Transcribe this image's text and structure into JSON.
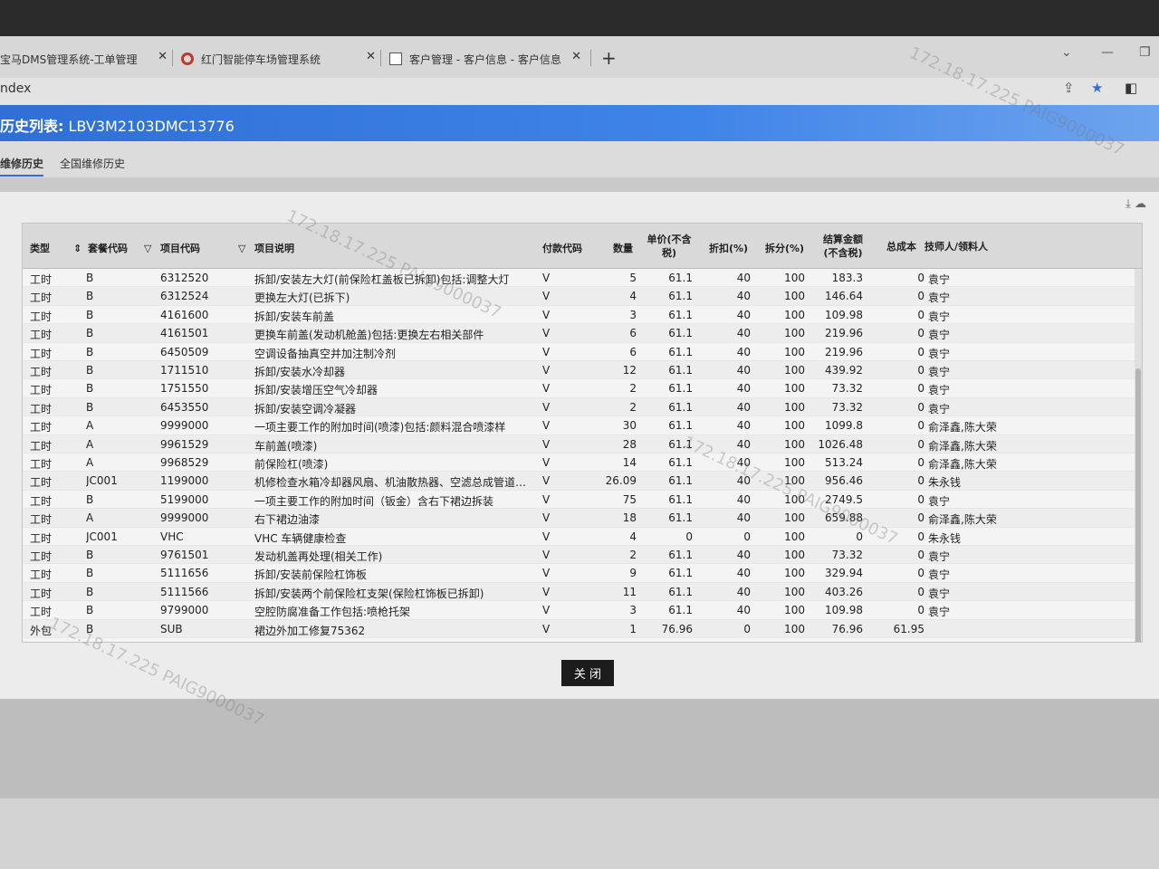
{
  "browser": {
    "tabs": [
      {
        "label": "宝马DMS管理系统-工单管理",
        "close": "✕"
      },
      {
        "label": "红门智能停车场管理系统",
        "close": "✕"
      },
      {
        "label": "客户管理 - 客户信息 - 客户信息",
        "close": "✕"
      }
    ],
    "new_tab": "+",
    "address": "ndex"
  },
  "app": {
    "title_prefix": "历史列表:",
    "vin": "LBV3M2103DMC13776",
    "subtabs": [
      "维修历史",
      "全国维修历史"
    ]
  },
  "table": {
    "headers": [
      "类型",
      "套餐代码",
      "项目代码",
      "项目说明",
      "付款代码",
      "数量",
      "单价(不含税)",
      "折扣(%)",
      "拆分(%)",
      "结算金额(不含税)",
      "总成本",
      "技师人/领料人"
    ],
    "rows": [
      [
        "工时",
        "B",
        "6312520",
        "拆卸/安装左大灯(前保险杠盖板已拆卸)包括:调整大灯",
        "V",
        "5",
        "61.1",
        "40",
        "100",
        "183.3",
        "0",
        "袁宁"
      ],
      [
        "工时",
        "B",
        "6312524",
        "更换左大灯(已拆下)",
        "V",
        "4",
        "61.1",
        "40",
        "100",
        "146.64",
        "0",
        "袁宁"
      ],
      [
        "工时",
        "B",
        "4161600",
        "拆卸/安装车前盖",
        "V",
        "3",
        "61.1",
        "40",
        "100",
        "109.98",
        "0",
        "袁宁"
      ],
      [
        "工时",
        "B",
        "4161501",
        "更换车前盖(发动机舱盖)包括:更换左右相关部件",
        "V",
        "6",
        "61.1",
        "40",
        "100",
        "219.96",
        "0",
        "袁宁"
      ],
      [
        "工时",
        "B",
        "6450509",
        "空调设备抽真空并加注制冷剂",
        "V",
        "6",
        "61.1",
        "40",
        "100",
        "219.96",
        "0",
        "袁宁"
      ],
      [
        "工时",
        "B",
        "1711510",
        "拆卸/安装水冷却器",
        "V",
        "12",
        "61.1",
        "40",
        "100",
        "439.92",
        "0",
        "袁宁"
      ],
      [
        "工时",
        "B",
        "1751550",
        "拆卸/安装增压空气冷却器",
        "V",
        "2",
        "61.1",
        "40",
        "100",
        "73.32",
        "0",
        "袁宁"
      ],
      [
        "工时",
        "B",
        "6453550",
        "拆卸/安装空调冷凝器",
        "V",
        "2",
        "61.1",
        "40",
        "100",
        "73.32",
        "0",
        "袁宁"
      ],
      [
        "工时",
        "A",
        "9999000",
        "一项主要工作的附加时间(喷漆)包括:颜料混合喷漆样",
        "V",
        "30",
        "61.1",
        "40",
        "100",
        "1099.8",
        "0",
        "俞泽鑫,陈大荣"
      ],
      [
        "工时",
        "A",
        "9961529",
        "车前盖(喷漆)",
        "V",
        "28",
        "61.1",
        "40",
        "100",
        "1026.48",
        "0",
        "俞泽鑫,陈大荣"
      ],
      [
        "工时",
        "A",
        "9968529",
        "前保险杠(喷漆)",
        "V",
        "14",
        "61.1",
        "40",
        "100",
        "513.24",
        "0",
        "俞泽鑫,陈大荣"
      ],
      [
        "工时",
        "JC001",
        "1199000",
        "机修检查水箱冷却器风扇、机油散热器、空滤总成管道等...",
        "V",
        "26.09",
        "61.1",
        "40",
        "100",
        "956.46",
        "0",
        "朱永钱"
      ],
      [
        "工时",
        "B",
        "5199000",
        "一项主要工作的附加时间（钣金）含右下裙边拆装",
        "V",
        "75",
        "61.1",
        "40",
        "100",
        "2749.5",
        "0",
        "袁宁"
      ],
      [
        "工时",
        "A",
        "9999000",
        "右下裙边油漆",
        "V",
        "18",
        "61.1",
        "40",
        "100",
        "659.88",
        "0",
        "俞泽鑫,陈大荣"
      ],
      [
        "工时",
        "JC001",
        "VHC",
        "VHC 车辆健康检查",
        "V",
        "4",
        "0",
        "0",
        "100",
        "0",
        "0",
        "朱永钱"
      ],
      [
        "工时",
        "B",
        "9761501",
        "发动机盖再处理(相关工作)",
        "V",
        "2",
        "61.1",
        "40",
        "100",
        "73.32",
        "0",
        "袁宁"
      ],
      [
        "工时",
        "B",
        "5111656",
        "拆卸/安装前保险杠饰板",
        "V",
        "9",
        "61.1",
        "40",
        "100",
        "329.94",
        "0",
        "袁宁"
      ],
      [
        "工时",
        "B",
        "5111566",
        "拆卸/安装两个前保险杠支架(保险杠饰板已拆卸)",
        "V",
        "11",
        "61.1",
        "40",
        "100",
        "403.26",
        "0",
        "袁宁"
      ],
      [
        "工时",
        "B",
        "9799000",
        "空腔防腐准备工作包括:喷枪托架",
        "V",
        "3",
        "61.1",
        "40",
        "100",
        "109.98",
        "0",
        "袁宁"
      ],
      [
        "外包",
        "B",
        "SUB",
        "裙边外加工修复75362",
        "V",
        "1",
        "76.96",
        "0",
        "100",
        "76.96",
        "61.95",
        ""
      ]
    ]
  },
  "close_button": "关 闭",
  "watermark": "172.18.17.225 PAIG9000037"
}
